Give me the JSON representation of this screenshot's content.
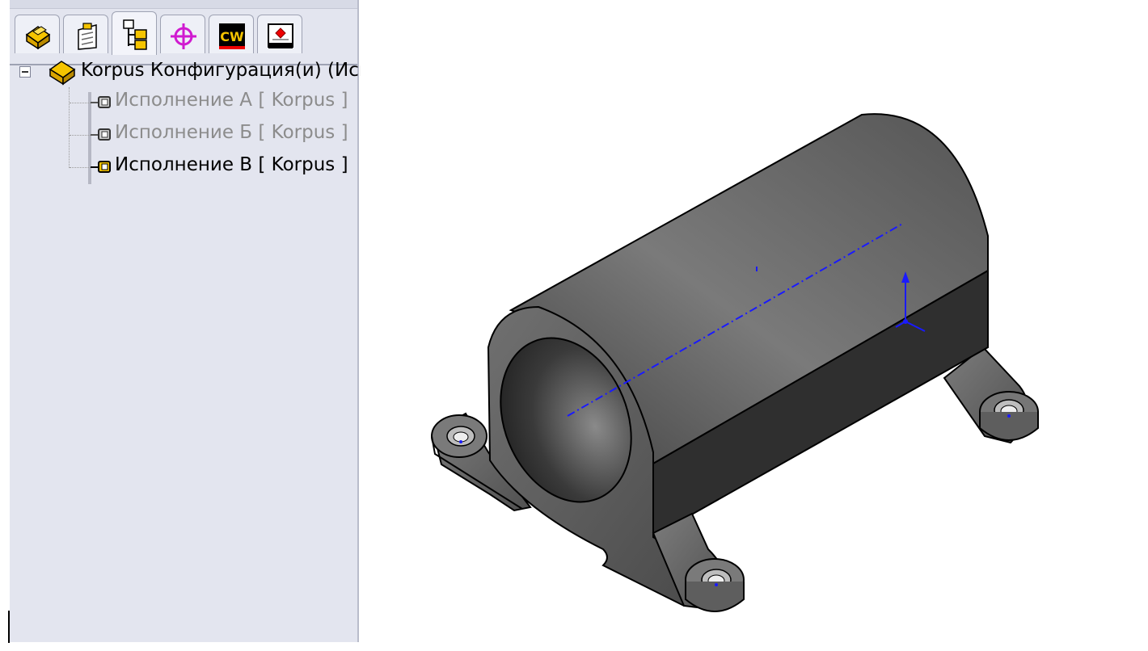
{
  "tabs": [
    {
      "name": "featuremanager-tab",
      "icon": "part-icon",
      "active": false
    },
    {
      "name": "propertymanager-tab",
      "icon": "property-sheet-icon",
      "active": false
    },
    {
      "name": "configurationmanager-tab",
      "icon": "configurations-icon",
      "active": true
    },
    {
      "name": "dimxpert-tab",
      "icon": "target-crosshair-icon",
      "active": false
    },
    {
      "name": "cosmosworks-tab",
      "icon": "cw-icon",
      "active": false,
      "text": "CW"
    },
    {
      "name": "display-manager-tab",
      "icon": "display-manager-icon",
      "active": false
    }
  ],
  "tree": {
    "root_label": "Korpus Конфигурация(и)  (Исп",
    "items": [
      {
        "label": "Исполнение А [ Korpus ]",
        "active": false
      },
      {
        "label": "Исполнение Б [ Korpus ]",
        "active": false
      },
      {
        "label": "Исполнение В [ Korpus ]",
        "active": true
      }
    ]
  },
  "colors": {
    "panel_bg": "#e3e5ef",
    "inactive_text": "#8c8c8c",
    "axis_blue": "#1a1aff",
    "model_gray": "#5a5a5a"
  },
  "model": {
    "description_name": "korpus-3d-model"
  }
}
